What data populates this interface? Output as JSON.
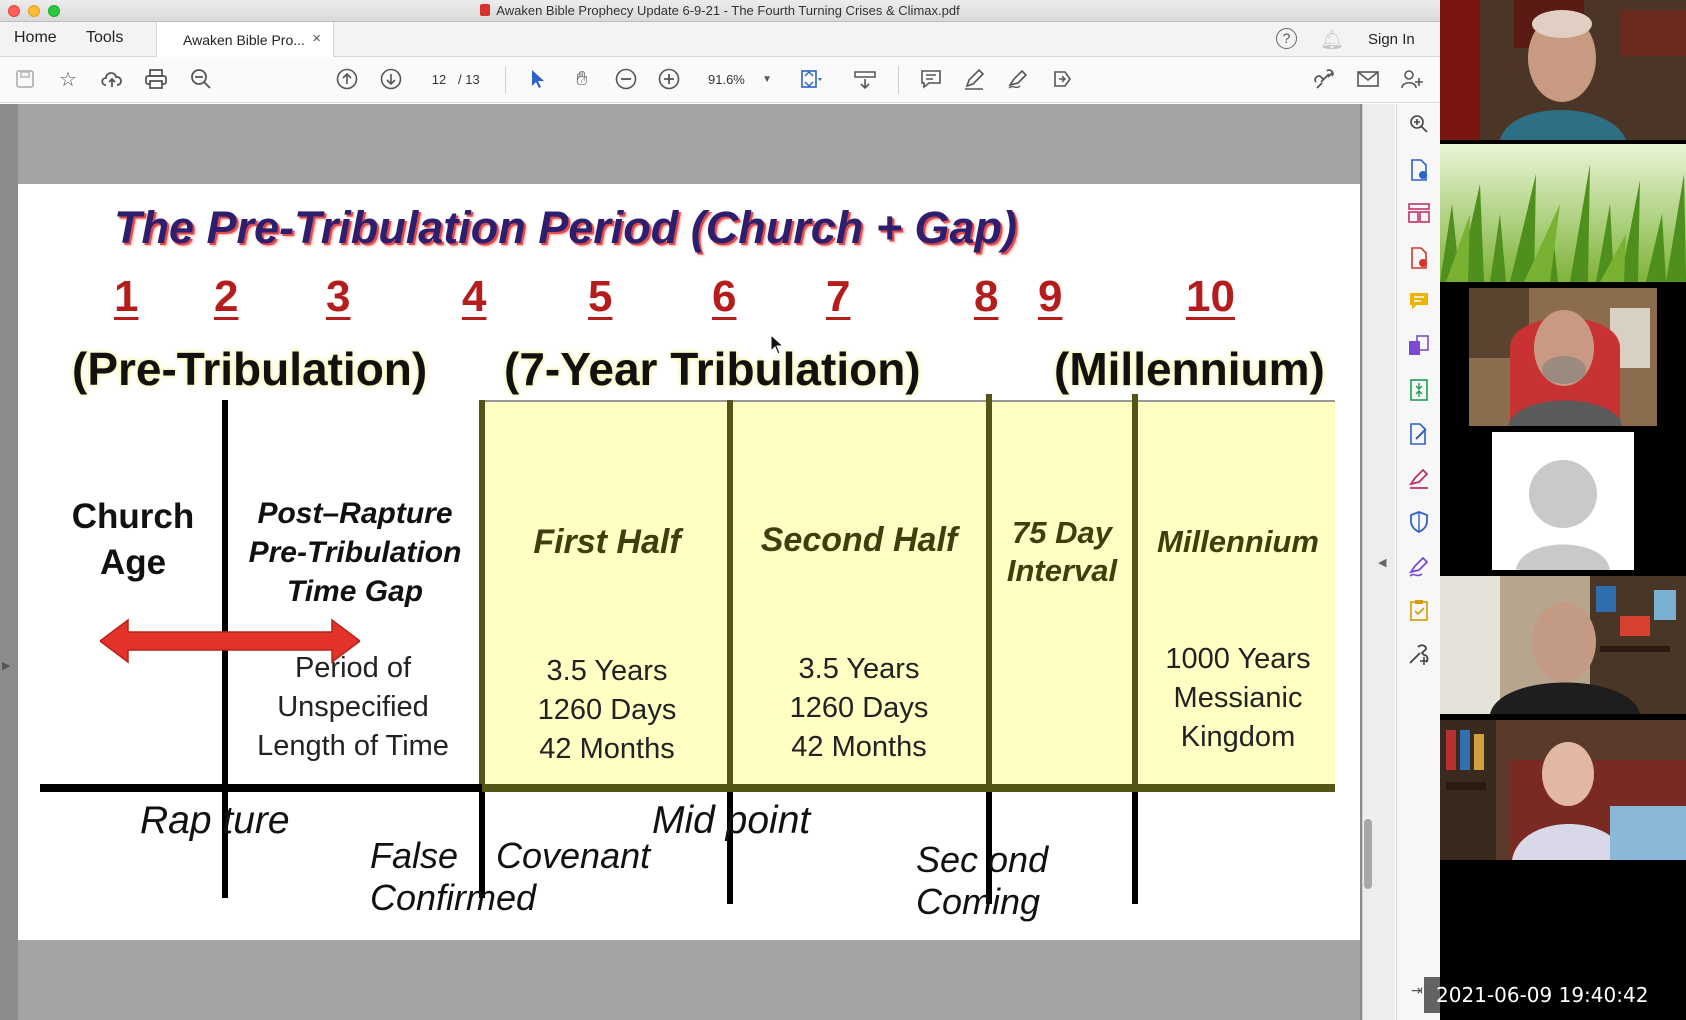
{
  "window": {
    "title": "Awaken Bible Prophecy Update 6-9-21 - The Fourth Turning Crises & Climax.pdf"
  },
  "tabs": {
    "home_label": "Home",
    "tools_label": "Tools",
    "document_tab_label": "Awaken Bible Pro...",
    "close_glyph": "×",
    "sign_in_label": "Sign In",
    "help_glyph": "?"
  },
  "toolbar": {
    "current_page": "12",
    "page_total": "/ 13",
    "zoom_level": "91.6%",
    "icons": [
      "save-icon",
      "star-icon",
      "cloud-upload-icon",
      "print-icon",
      "zoom-out-search-icon",
      "page-up-icon",
      "page-down-icon",
      "select-cursor-icon",
      "hand-icon",
      "zoom-out-icon",
      "zoom-in-icon",
      "zoom-dropdown",
      "fit-page-icon",
      "scroll-mode-icon",
      "comment-icon",
      "highlight-pen-icon",
      "sign-icon",
      "share-icon",
      "link-icon",
      "email-icon",
      "add-user-icon"
    ]
  },
  "slide": {
    "title": "The Pre-Tribulation Period (Church + Gap)",
    "numbers": [
      "1",
      "2",
      "3",
      "4",
      "5",
      "6",
      "7",
      "8",
      "9",
      "10"
    ],
    "periods": {
      "pre": "(Pre-Tribulation)",
      "tribulation": "(7-Year Tribulation)",
      "millennium": "(Millennium)"
    },
    "church_age": [
      "Church",
      "Age"
    ],
    "gap_heading": [
      "Post–Rapture",
      "Pre-Tribulation",
      "Time Gap"
    ],
    "gap_body": [
      "Period of",
      "Unspecified",
      "Length of Time"
    ],
    "first_half": {
      "heading": "First Half",
      "lines": [
        "3.5 Years",
        "1260 Days",
        "42 Months"
      ]
    },
    "second_half": {
      "heading": "Second Half",
      "lines": [
        "3.5 Years",
        "1260 Days",
        "42 Months"
      ]
    },
    "interval": {
      "heading": [
        "75 Day",
        "Interval"
      ]
    },
    "millennium": {
      "heading": "Millennium",
      "lines": [
        "1000 Years",
        "Messianic",
        "Kingdom"
      ]
    },
    "events": {
      "rapture": "Rap ture",
      "false_covenant": [
        "False",
        "Covenant"
      ],
      "confirmed": "Confirmed",
      "midpoint": "Mid point",
      "second_coming": [
        "Sec ond",
        "Coming"
      ]
    },
    "colors": {
      "title": "#2e1f6e",
      "numbers": "#b51d1d",
      "yellow_band": "#ffffc4",
      "arrow": "#e3322a",
      "olive": "#545417"
    }
  },
  "side_tools": [
    "zoom-icon",
    "export-pdf-icon",
    "create-pdf-icon",
    "organize-pages-icon",
    "edit-pdf-icon",
    "comment-icon",
    "combine-icon",
    "compress-icon",
    "protect-icon",
    "fill-sign-icon",
    "send-sign-icon",
    "more-tools-icon"
  ],
  "gallery": {
    "timestamp": "2021-06-09 19:40:42"
  }
}
